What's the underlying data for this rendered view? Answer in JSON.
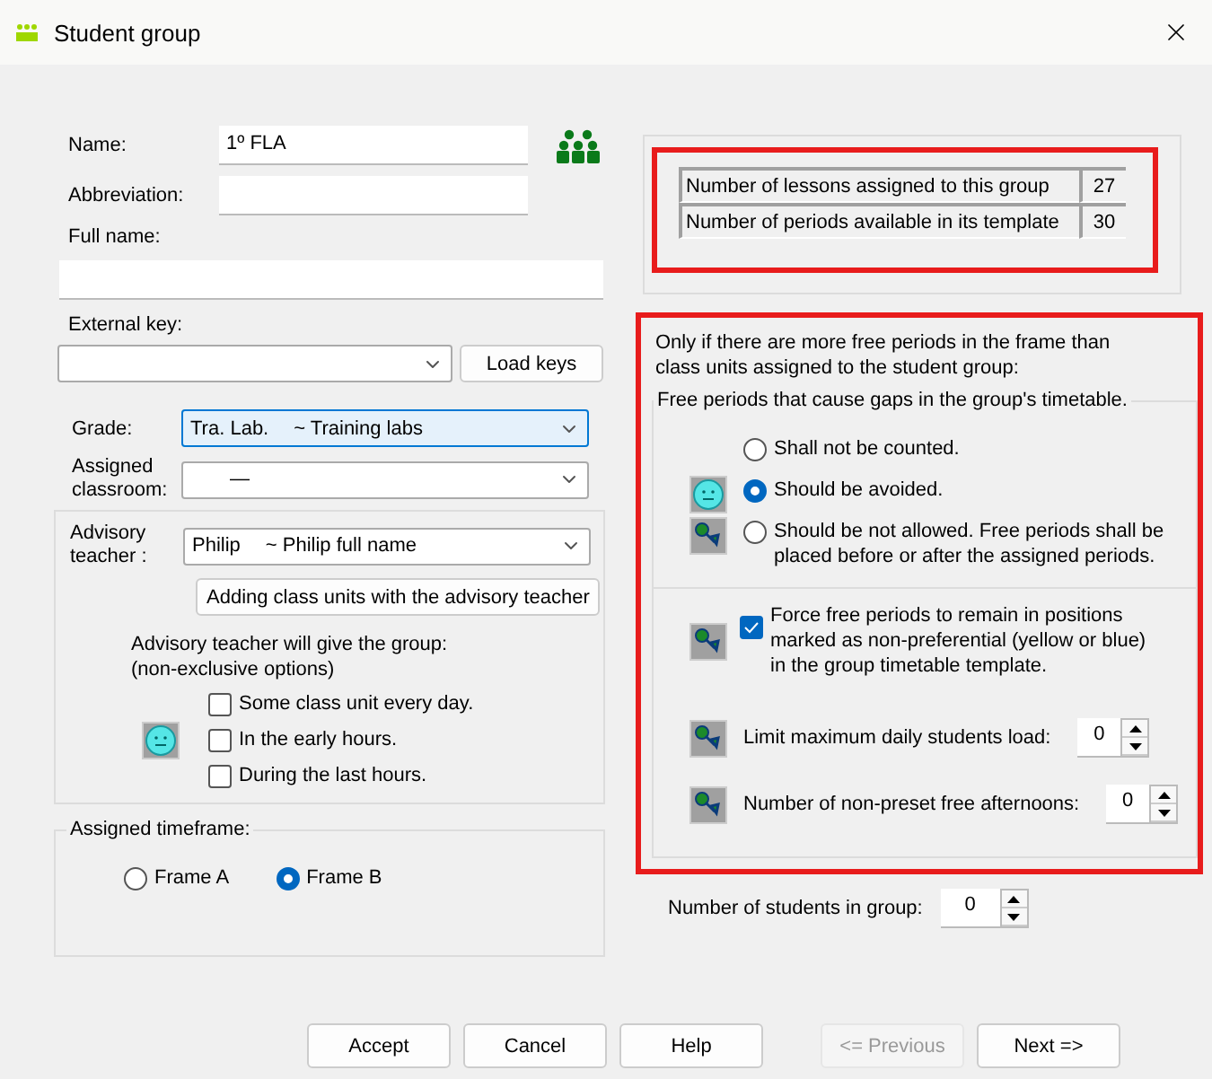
{
  "window": {
    "title": "Student group"
  },
  "form": {
    "name": {
      "label": "Name:",
      "value": "1º FLA"
    },
    "abbreviation": {
      "label": "Abbreviation:"
    },
    "full_name": {
      "label": "Full name:"
    },
    "external_key": {
      "label": "External key:",
      "button": "Load keys"
    },
    "grade": {
      "label": "Grade:",
      "value": "Tra. Lab.",
      "description": "~ Training labs",
      "focused": true
    },
    "classroom": {
      "label": "Assigned classroom:",
      "value": "—"
    }
  },
  "advisory": {
    "label": "Advisory teacher :",
    "value": "Philip",
    "description": "~ Philip full name",
    "button": "Adding class units with the advisory teacher",
    "intro": [
      "Advisory teacher will give the group:",
      "(non-exclusive options)"
    ],
    "options": [
      {
        "label": "Some class unit every day.",
        "checked": false
      },
      {
        "label": "In the early hours.",
        "checked": false
      },
      {
        "label": "During the last hours.",
        "checked": false
      }
    ]
  },
  "timeframe": {
    "legend": "Assigned timeframe:",
    "options": [
      {
        "label": "Frame A",
        "selected": false
      },
      {
        "label": "Frame B",
        "selected": true
      }
    ]
  },
  "stats": [
    {
      "label": "Number of lessons assigned to this group",
      "value": "27"
    },
    {
      "label": "Number of periods available in its template",
      "value": "30"
    }
  ],
  "free_periods": {
    "intro": [
      "Only if there are more free periods in the frame than",
      "class units assigned to the student group:"
    ],
    "legend": "Free periods that cause gaps in the group's timetable.",
    "options": [
      {
        "label": "Shall not be counted.",
        "selected": false
      },
      {
        "label": "Should be avoided.",
        "selected": true
      },
      {
        "label": "Should be not allowed. Free periods shall be placed before or after the assigned periods.",
        "selected": false
      }
    ],
    "force": {
      "label": "Force free periods to remain in positions marked as non-preferential (yellow or blue) in the group timetable template.",
      "checked": true
    },
    "spins": [
      {
        "label": "Limit maximum daily students load:",
        "value": "0"
      },
      {
        "label": "Number of non-preset free afternoons:",
        "value": "0"
      }
    ]
  },
  "students": {
    "label": "Number of students in group:",
    "value": "0"
  },
  "buttons": [
    {
      "label": "Accept",
      "disabled": false
    },
    {
      "label": "Cancel",
      "disabled": false
    },
    {
      "label": "Help",
      "disabled": false
    },
    {
      "label": "<= Previous",
      "disabled": true
    },
    {
      "label": "Next =>",
      "disabled": false
    }
  ]
}
